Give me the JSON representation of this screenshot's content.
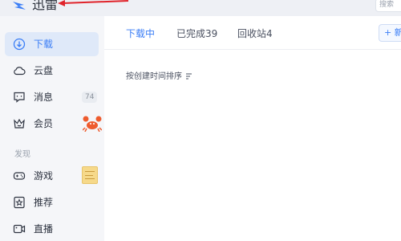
{
  "titlebar": {
    "app_title": "迅雷",
    "search_placeholder": "搜索"
  },
  "sidebar": {
    "items": [
      {
        "label": "下载",
        "icon": "download-icon",
        "active": true
      },
      {
        "label": "云盘",
        "icon": "cloud-icon"
      },
      {
        "label": "消息",
        "icon": "message-icon",
        "badge": "74"
      },
      {
        "label": "会员",
        "icon": "crown-icon"
      }
    ],
    "discover_title": "发现",
    "discover_items": [
      {
        "label": "游戏",
        "icon": "gamepad-icon"
      },
      {
        "label": "推荐",
        "icon": "star-icon"
      },
      {
        "label": "直播",
        "icon": "live-icon"
      }
    ]
  },
  "main": {
    "tabs": [
      {
        "label": "下载中",
        "active": true
      },
      {
        "label": "已完成39"
      },
      {
        "label": "回收站4"
      }
    ],
    "new_button_label": "+ 新",
    "sort_label": "按创建时间排序"
  },
  "colors": {
    "accent": "#3b7ef6",
    "sidebar_bg": "#f5f6f9",
    "active_item_bg": "#dfe9f9",
    "annotation_arrow": "#e0242b",
    "crab": "#ee5b2e"
  }
}
